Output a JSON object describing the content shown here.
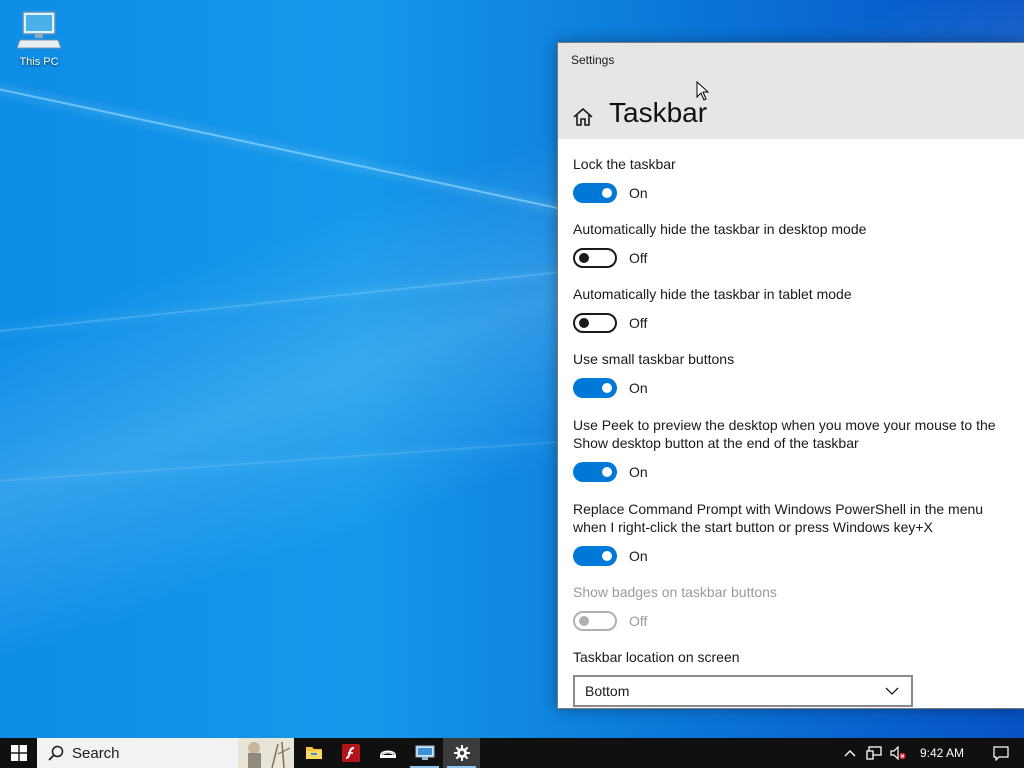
{
  "desktop": {
    "icons": [
      {
        "label": "This PC",
        "icon": "computer-icon"
      }
    ]
  },
  "window": {
    "title": "Settings",
    "page_title": "Taskbar",
    "home_icon": "home-icon"
  },
  "settings": [
    {
      "label": "Lock the taskbar",
      "state": "On",
      "enabled": true
    },
    {
      "label": "Automatically hide the taskbar in desktop mode",
      "state": "Off",
      "enabled": true
    },
    {
      "label": "Automatically hide the taskbar in tablet mode",
      "state": "Off",
      "enabled": true
    },
    {
      "label": "Use small taskbar buttons",
      "state": "On",
      "enabled": true
    },
    {
      "label": "Use Peek to preview the desktop when you move your mouse to the Show desktop button at the end of the taskbar",
      "state": "On",
      "enabled": true
    },
    {
      "label": "Replace Command Prompt with Windows PowerShell in the menu when I right-click the start button or press Windows key+X",
      "state": "On",
      "enabled": true
    },
    {
      "label": "Show badges on taskbar buttons",
      "state": "Off",
      "enabled": false
    }
  ],
  "location": {
    "label": "Taskbar location on screen",
    "selected": "Bottom"
  },
  "taskbar": {
    "search_placeholder": "Search",
    "apps": [
      {
        "name": "file-explorer-icon",
        "running": false,
        "active": false
      },
      {
        "name": "flash-icon",
        "running": false,
        "active": false
      },
      {
        "name": "app-icon",
        "running": false,
        "active": false
      },
      {
        "name": "remote-desktop-icon",
        "running": true,
        "active": false
      },
      {
        "name": "settings-gear-icon",
        "running": true,
        "active": true
      }
    ],
    "clock": "9:42 AM"
  },
  "colors": {
    "accent": "#0078d7",
    "header_bg": "#e6e6e6",
    "taskbar_bg": "#101010"
  }
}
